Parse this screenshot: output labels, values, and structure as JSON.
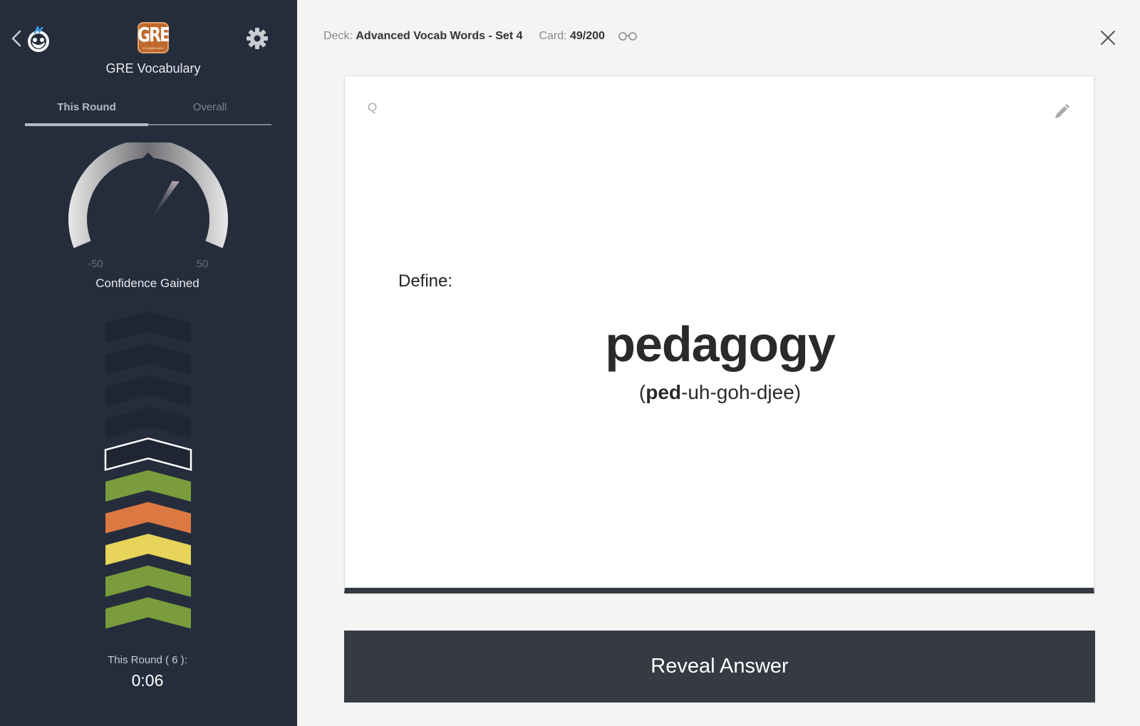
{
  "sidebar": {
    "deck_name": "GRE Vocabulary",
    "logo_text": "GRE",
    "logo_subtext": "VOCABULARY",
    "tabs": [
      {
        "label": "This Round",
        "active": true
      },
      {
        "label": "Overall",
        "active": false
      }
    ],
    "gauge": {
      "min_label": "-50",
      "max_label": "50",
      "label": "Confidence Gained",
      "needle_fraction": 0.62
    },
    "confidence_levels": [
      {
        "state": "empty",
        "color": "#1f2533"
      },
      {
        "state": "empty",
        "color": "#1f2533"
      },
      {
        "state": "empty",
        "color": "#1f2533"
      },
      {
        "state": "empty",
        "color": "#1f2533"
      },
      {
        "state": "current",
        "color": "#1f2533"
      },
      {
        "state": "filled",
        "color": "#7a9c3c"
      },
      {
        "state": "filled",
        "color": "#dc7842"
      },
      {
        "state": "filled",
        "color": "#e8d45a"
      },
      {
        "state": "filled",
        "color": "#7a9c3c"
      },
      {
        "state": "filled",
        "color": "#7a9c3c"
      }
    ],
    "timer_label": "This Round ( 6 ):",
    "timer_value": "0:06"
  },
  "header": {
    "deck_label": "Deck:",
    "deck_value": "Advanced Vocab Words - Set 4",
    "card_label": "Card:",
    "card_value": "49/200"
  },
  "card": {
    "side_marker": "Q",
    "prompt": "Define:",
    "word": "pedagogy",
    "pron_open": "(",
    "pron_stressed": "ped",
    "pron_rest": "-uh-goh-djee)"
  },
  "reveal_label": "Reveal Answer",
  "colors": {
    "sidebar_bg": "#252d3c",
    "button_bg": "#353a43",
    "accent_orange": "#c0692c"
  }
}
